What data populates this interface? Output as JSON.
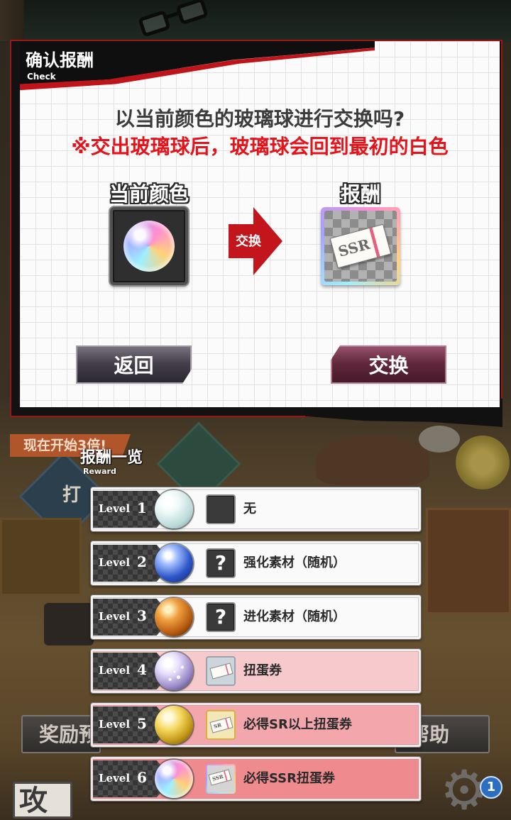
{
  "modal": {
    "title": "确认报酬",
    "title_en": "Check",
    "question": "以当前颜色的玻璃球进行交换吗?",
    "warning": "※交出玻璃球后，玻璃球会回到最初的白色",
    "current_label": "当前颜色",
    "current_item_icon": "rainbow-glass-ball-icon",
    "arrow_label": "交换",
    "reward_label": "报酬",
    "reward_item": {
      "icon": "ssr-ticket-icon",
      "text": "SSR"
    },
    "back_button": "返回",
    "exchange_button": "交换"
  },
  "reward_list": {
    "title": "报酬一览",
    "title_en": "Reward",
    "level_word": "Level",
    "rows": [
      {
        "level": "1",
        "ball": "clear-glass-ball-icon",
        "reward_icon": "empty-slot-icon",
        "reward": "无",
        "bg": "#fafafa"
      },
      {
        "level": "2",
        "ball": "blue-glass-ball-icon",
        "reward_icon": "mystery-item-icon",
        "icon_text": "?",
        "reward": "强化素材（随机）",
        "bg": "#fafafa"
      },
      {
        "level": "3",
        "ball": "orange-glass-ball-icon",
        "reward_icon": "mystery-item-icon",
        "icon_text": "?",
        "reward": "进化素材（随机）",
        "bg": "#fafafa"
      },
      {
        "level": "4",
        "ball": "starry-glass-ball-icon",
        "reward_icon": "gacha-ticket-icon",
        "reward": "扭蛋券",
        "bg": "#f6c9cc"
      },
      {
        "level": "5",
        "ball": "gold-glass-ball-icon",
        "reward_icon": "sr-ticket-icon",
        "icon_text": "SR",
        "reward": "必得SR以上扭蛋券",
        "bg": "#f3a7ad"
      },
      {
        "level": "6",
        "ball": "rainbow-glass-ball-icon",
        "reward_icon": "ssr-ticket-icon",
        "icon_text": "SSR",
        "reward": "必得SSR扭蛋券",
        "bg": "#ef8a8f"
      }
    ]
  },
  "background": {
    "banner": "现在开始3倍!",
    "partial_text": "打",
    "left_button": "奖励预",
    "right_button": "帮助",
    "stamp": "攻",
    "badge_count": "1",
    "decorations": [
      "eyeglasses-decoration",
      "gear-icon",
      "flower-decoration"
    ]
  },
  "colors": {
    "warning_red": "#e3141b",
    "arrow_red": "#c3151c",
    "modal_border_red": "#9d1519",
    "header_black": "#0f0f0f",
    "back_button": "#45404c",
    "exchange_button": "#62283c",
    "badge_blue": "#2a6fc0"
  }
}
